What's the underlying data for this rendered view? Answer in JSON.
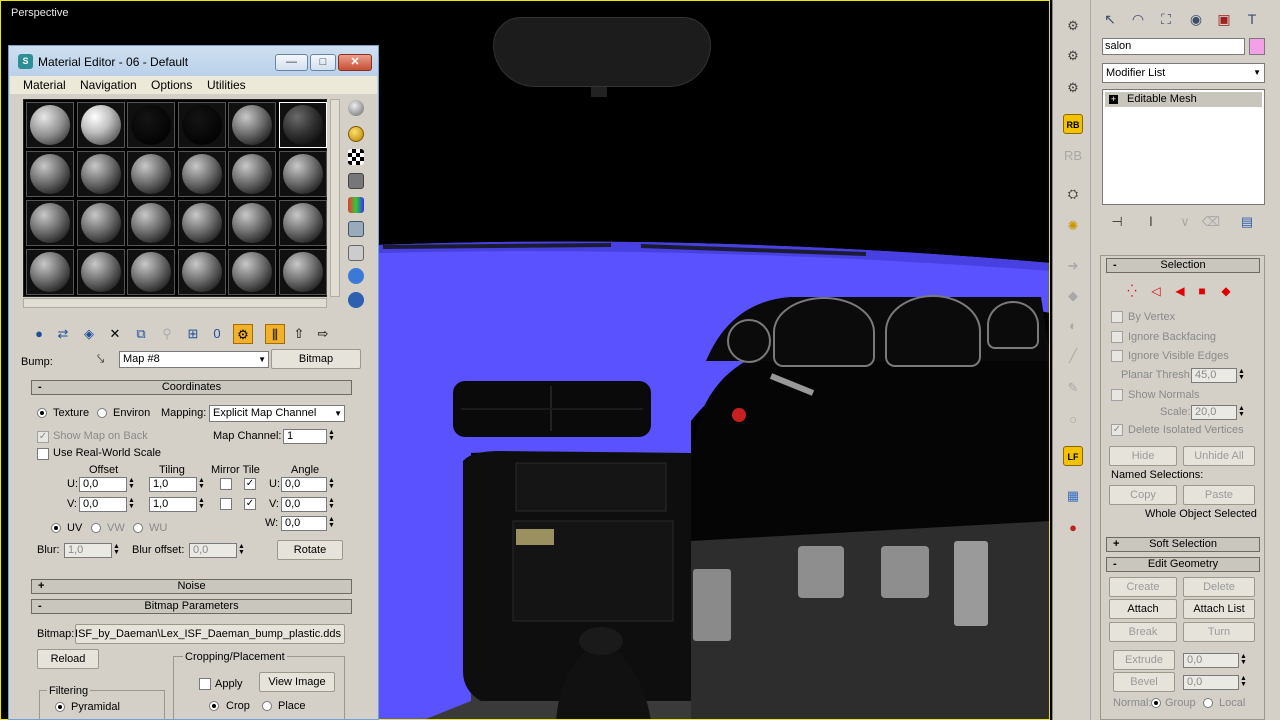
{
  "viewport": {
    "label": "Perspective"
  },
  "material_editor": {
    "title": "Material Editor - 06 - Default",
    "window_buttons": {
      "minimize": "—",
      "maximize": "□",
      "close": "✕"
    },
    "menu": [
      "Material",
      "Navigation",
      "Options",
      "Utilities"
    ],
    "slot_rows": 4,
    "slot_cols": 6,
    "bump_label": "Bump:",
    "map_name": "Map #8",
    "map_type_button": "Bitmap",
    "coordinates": {
      "header": "Coordinates",
      "texture_label": "Texture",
      "environ_label": "Environ",
      "mapping_label": "Mapping:",
      "mapping_value": "Explicit Map Channel",
      "show_map_on_back": "Show Map on Back",
      "map_channel_label": "Map Channel:",
      "map_channel_value": "1",
      "use_real_world": "Use Real-World Scale",
      "col_offset": "Offset",
      "col_tiling": "Tiling",
      "col_mirror_tile": "Mirror Tile",
      "col_angle": "Angle",
      "u_label": "U:",
      "v_label": "V:",
      "w_label": "W:",
      "u_offset": "0,0",
      "v_offset": "0,0",
      "u_tiling": "1,0",
      "v_tiling": "1,0",
      "u_angle": "0,0",
      "v_angle": "0,0",
      "w_angle": "0,0",
      "uv": "UV",
      "vw": "VW",
      "wu": "WU",
      "blur_label": "Blur:",
      "blur_value": "1,0",
      "blur_offset_label": "Blur offset:",
      "blur_offset_value": "0,0",
      "rotate_button": "Rotate"
    },
    "noise_header": "Noise",
    "bitmap_params": {
      "header": "Bitmap Parameters",
      "bitmap_label": "Bitmap:",
      "bitmap_path": "exISF_by_Daeman\\Lex_ISF_Daeman_bump_plastic.dds",
      "reload_button": "Reload",
      "cropping_label": "Cropping/Placement",
      "apply_label": "Apply",
      "view_image_button": "View Image",
      "crop_label": "Crop",
      "place_label": "Place",
      "filtering_label": "Filtering",
      "pyramidal_label": "Pyramidal"
    }
  },
  "command_panel": {
    "object_name": "salon",
    "object_color": "#f4a0e6",
    "modifier_list": "Modifier List",
    "stack_item": "Editable Mesh",
    "selection": {
      "header": "Selection",
      "by_vertex": "By Vertex",
      "ignore_backfacing": "Ignore Backfacing",
      "ignore_visible_edges": "Ignore Visible Edges",
      "planar_thresh_label": "Planar Thresh:",
      "planar_thresh_value": "45,0",
      "show_normals": "Show Normals",
      "scale_label": "Scale:",
      "scale_value": "20,0",
      "delete_isolated": "Delete Isolated Vertices",
      "hide_button": "Hide",
      "unhide_all_button": "Unhide All",
      "named_selections": "Named Selections:",
      "copy_button": "Copy",
      "paste_button": "Paste",
      "status": "Whole Object Selected"
    },
    "soft_selection_header": "Soft Selection",
    "edit_geometry": {
      "header": "Edit Geometry",
      "create": "Create",
      "delete": "Delete",
      "attach": "Attach",
      "attach_list": "Attach List",
      "break": "Break",
      "turn": "Turn",
      "extrude": "Extrude",
      "extrude_value": "0,0",
      "bevel": "Bevel",
      "bevel_value": "0,0",
      "normal_label": "Normal:",
      "group_label": "Group",
      "local_label": "Local"
    }
  },
  "rightbar": {
    "rb1": "RB",
    "rb2": "RB",
    "lf": "LF"
  },
  "colors": {
    "accent_dash": "#5a52ff",
    "active_frame": "#e8e800"
  }
}
